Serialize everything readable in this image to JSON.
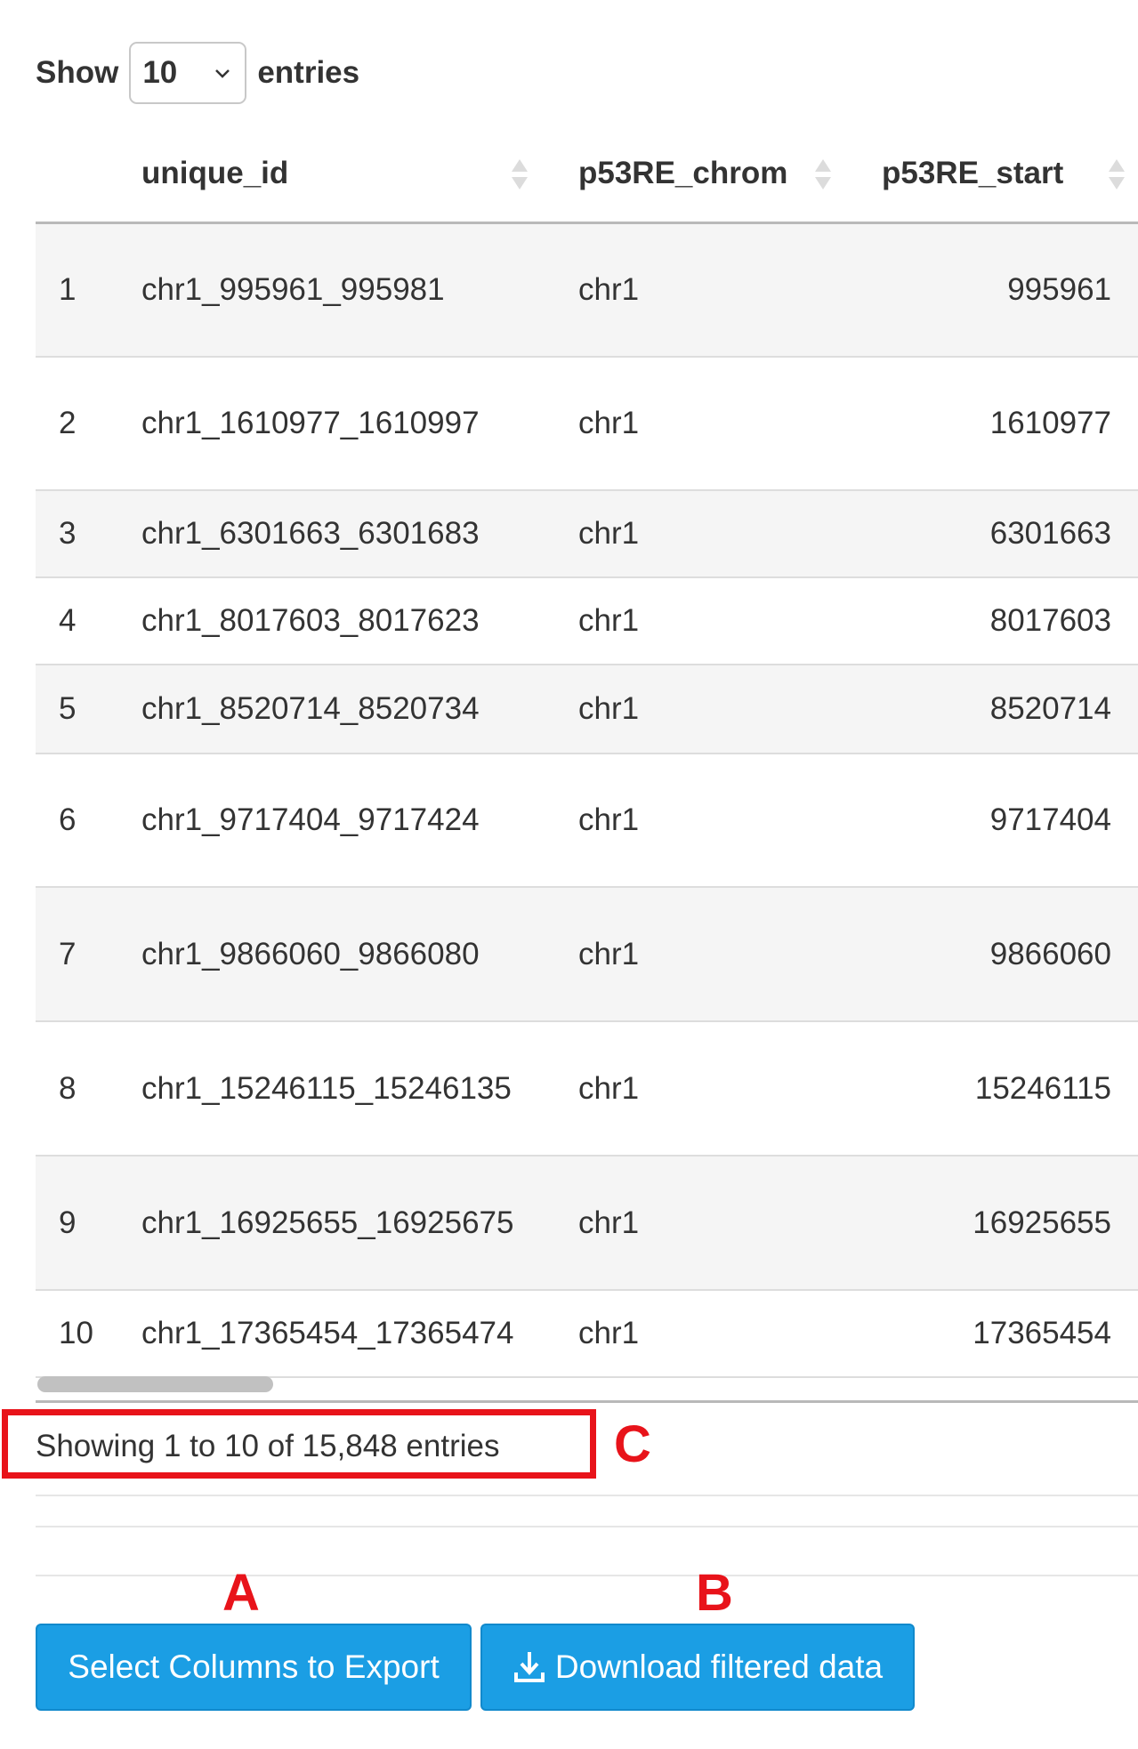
{
  "length_menu": {
    "show_label": "Show",
    "selected": "10",
    "entries_label": "entries"
  },
  "table": {
    "columns": [
      "",
      "unique_id",
      "p53RE_chrom",
      "p53RE_start"
    ],
    "rows": [
      {
        "idx": "1",
        "unique_id": "chr1_995961_995981",
        "chrom": "chr1",
        "start": "995961"
      },
      {
        "idx": "2",
        "unique_id": "chr1_1610977_1610997",
        "chrom": "chr1",
        "start": "1610977"
      },
      {
        "idx": "3",
        "unique_id": "chr1_6301663_6301683",
        "chrom": "chr1",
        "start": "6301663"
      },
      {
        "idx": "4",
        "unique_id": "chr1_8017603_8017623",
        "chrom": "chr1",
        "start": "8017603"
      },
      {
        "idx": "5",
        "unique_id": "chr1_8520714_8520734",
        "chrom": "chr1",
        "start": "8520714"
      },
      {
        "idx": "6",
        "unique_id": "chr1_9717404_9717424",
        "chrom": "chr1",
        "start": "9717404"
      },
      {
        "idx": "7",
        "unique_id": "chr1_9866060_9866080",
        "chrom": "chr1",
        "start": "9866060"
      },
      {
        "idx": "8",
        "unique_id": "chr1_15246115_15246135",
        "chrom": "chr1",
        "start": "15246115"
      },
      {
        "idx": "9",
        "unique_id": "chr1_16925655_16925675",
        "chrom": "chr1",
        "start": "16925655"
      },
      {
        "idx": "10",
        "unique_id": "chr1_17365454_17365474",
        "chrom": "chr1",
        "start": "17365454"
      }
    ]
  },
  "info": {
    "text": "Showing 1 to 10 of 15,848 entries"
  },
  "annotations": {
    "a": "A",
    "b": "B",
    "c": "C",
    "color": "#e8131a"
  },
  "buttons": {
    "select_columns": "Select Columns to Export",
    "download": "Download filtered data",
    "color": "#1b9ee4"
  },
  "icons": [
    "chevron-down-icon",
    "sort-icon",
    "download-icon"
  ]
}
